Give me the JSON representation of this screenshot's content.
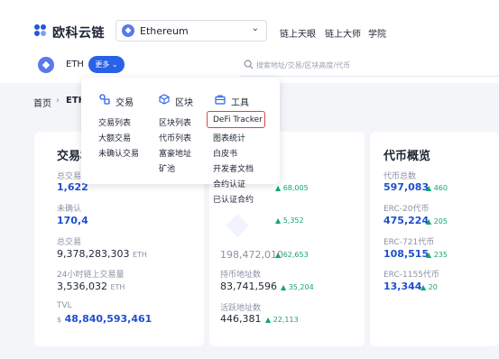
{
  "brand": {
    "name": "欧科云链",
    "color": "#1e5bd8"
  },
  "chain_selector": {
    "value": "Ethereum"
  },
  "top_nav": [
    "链上天眼",
    "链上大师",
    "学院"
  ],
  "token_row": {
    "label": "ETH",
    "more_button": "更多"
  },
  "search": {
    "placeholder": "搜索地址/交易/区块高度/代币"
  },
  "breadcrumb": {
    "home": "首页",
    "separator": "›",
    "current": "ETH"
  },
  "dropdown": {
    "columns": [
      {
        "title": "交易",
        "icon": "swap-icon",
        "items": [
          "交易列表",
          "大额交易",
          "未确认交易"
        ]
      },
      {
        "title": "区块",
        "icon": "cube-icon",
        "items": [
          "区块列表",
          "代币列表",
          "富豪地址",
          "矿池"
        ]
      },
      {
        "title": "工具",
        "icon": "toolbox-icon",
        "items": [
          "DeFi Tracker",
          "图表统计",
          "白皮书",
          "开发者文档",
          "合约认证",
          "已认证合约"
        ]
      }
    ],
    "highlighted_item": "DeFi Tracker",
    "highlight_color": "#d64545"
  },
  "cards": {
    "transactions": {
      "title": "交易概览",
      "title_visible": "交易概",
      "stats": [
        {
          "label": "总交易",
          "value": "1,622"
        },
        {
          "label": "未确认",
          "value": "170,4"
        },
        {
          "label": "总交易",
          "value": "9,378,283,303",
          "unit": "ETH"
        },
        {
          "label": "24小时链上交易量",
          "value": "3,536,032",
          "unit": "ETH"
        },
        {
          "label": "TVL",
          "prefix": "$",
          "value": "48,840,593,461"
        }
      ]
    },
    "addresses": {
      "stats": [
        {
          "change": "68,005"
        },
        {
          "change": "5,352"
        },
        {
          "value": "198,472,010",
          "change": "62,653"
        },
        {
          "label": "持币地址数",
          "value": "83,741,596",
          "change": "35,204"
        },
        {
          "label": "活跃地址数",
          "value": "446,381",
          "change": "22,113"
        }
      ]
    },
    "tokens": {
      "title": "代币概览",
      "stats": [
        {
          "label": "代币总数",
          "value": "597,083",
          "change": "460"
        },
        {
          "label": "ERC-20代币",
          "value": "475,224",
          "change": "205"
        },
        {
          "label": "ERC-721代币",
          "value": "108,515",
          "change": "235"
        },
        {
          "label": "ERC-1155代币",
          "value": "13,344",
          "change": "20"
        }
      ]
    }
  },
  "colors": {
    "accent": "#2962e8",
    "value_blue": "#1e4fd0",
    "increase_green": "#13a86b",
    "background": "#f3f5f9"
  }
}
